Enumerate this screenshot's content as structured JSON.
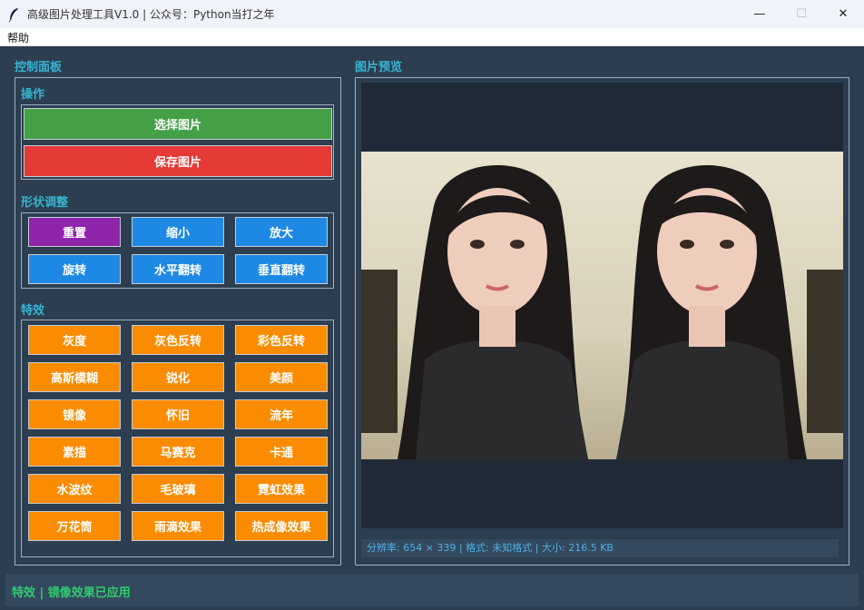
{
  "window": {
    "title": "高级图片处理工具V1.0 | 公众号：Python当打之年",
    "icon": "feather-icon",
    "minimize_glyph": "—",
    "maximize_glyph": "☐",
    "close_glyph": "✕"
  },
  "menu": {
    "help": "帮助"
  },
  "control_panel": {
    "title": "控制面板",
    "operations": {
      "title": "操作",
      "select_image": "选择图片",
      "save_image": "保存图片"
    },
    "shape": {
      "title": "形状调整",
      "buttons": [
        "重置",
        "缩小",
        "放大",
        "旋转",
        "水平翻转",
        "垂直翻转"
      ]
    },
    "effects": {
      "title": "特效",
      "buttons": [
        "灰度",
        "灰色反转",
        "彩色反转",
        "高斯模糊",
        "锐化",
        "美颜",
        "镜像",
        "怀旧",
        "流年",
        "素描",
        "马赛克",
        "卡通",
        "水波纹",
        "毛玻璃",
        "霓虹效果",
        "万花筒",
        "雨滴效果",
        "热成像效果"
      ]
    }
  },
  "preview": {
    "title": "图片预览",
    "info": "分辨率: 654 × 339 | 格式: 未知格式 | 大小: 216.5 KB"
  },
  "status": {
    "text": "特效 | 镜像效果已应用"
  },
  "colors": {
    "background": "#2c3e50",
    "accent_title": "#36b6d4",
    "green": "#43a047",
    "red": "#e53935",
    "purple": "#8e24aa",
    "blue": "#1e88e5",
    "orange": "#fb8c00",
    "status_text": "#2ecc71"
  }
}
